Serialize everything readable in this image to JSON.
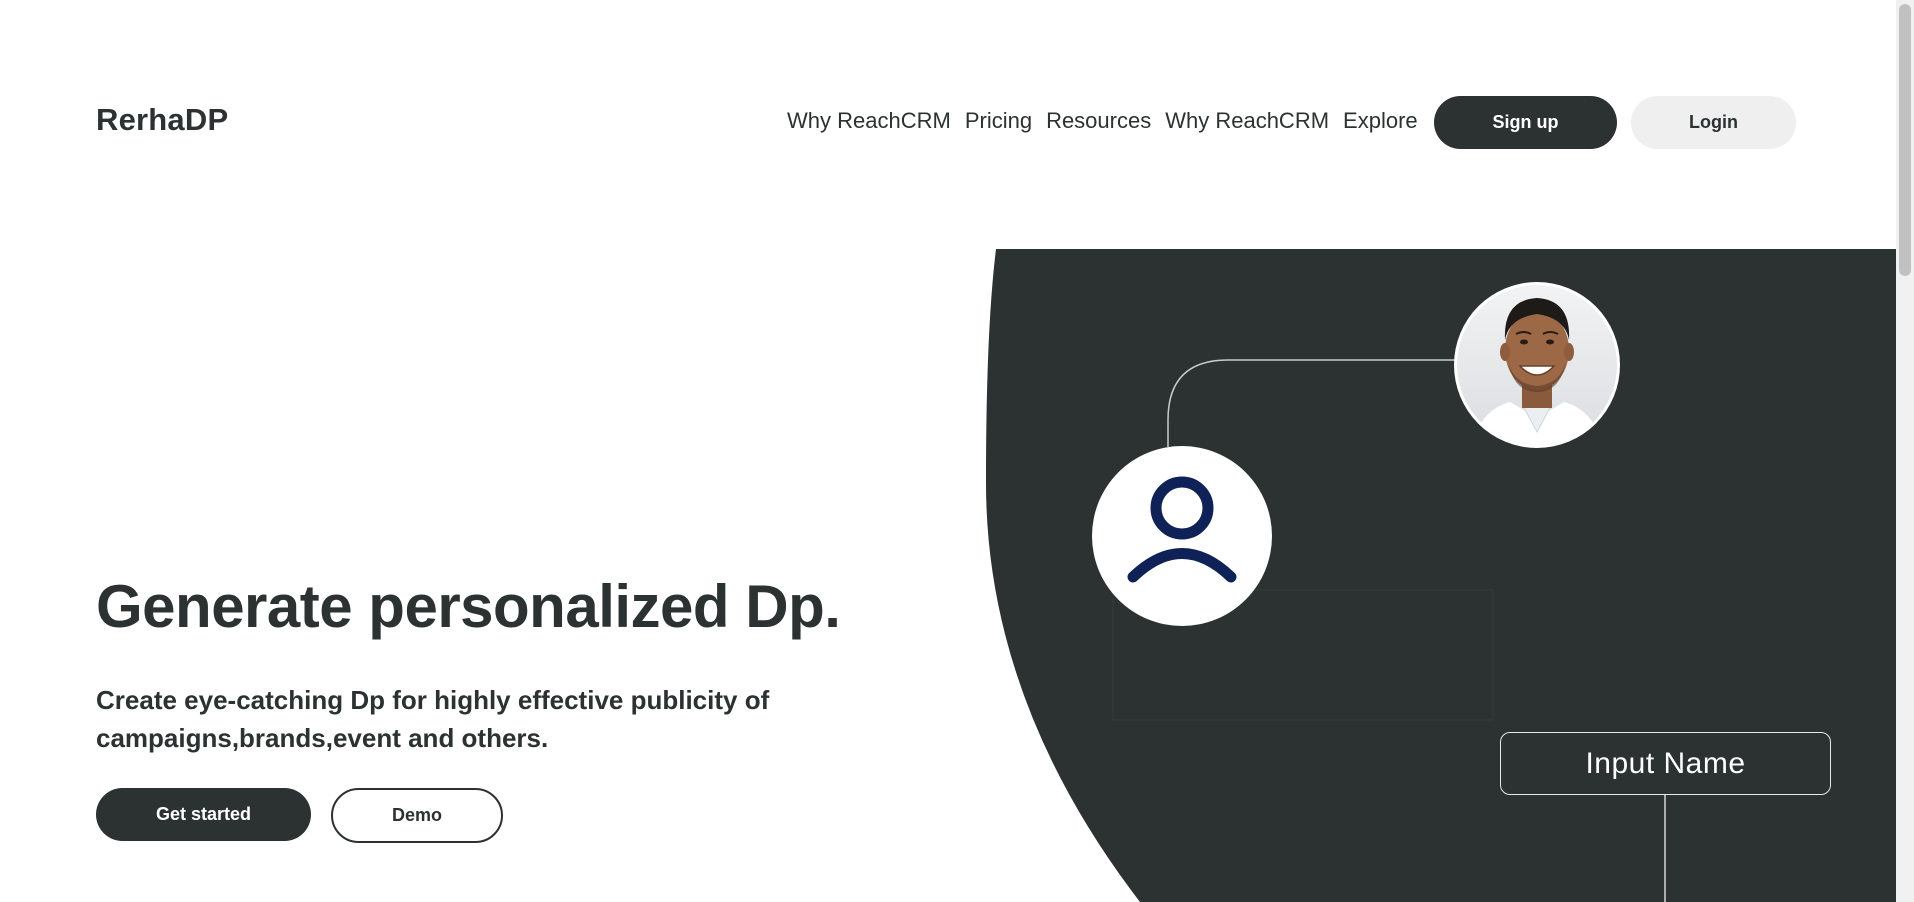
{
  "header": {
    "logo": "RerhaDP",
    "nav": [
      "Why ReachCRM",
      "Pricing",
      "Resources",
      "Why ReachCRM",
      "Explore"
    ],
    "signup_label": "Sign up",
    "login_label": "Login"
  },
  "hero": {
    "title": "Generate personalized Dp.",
    "subtitle": "Create eye-catching Dp for highly effective publicity of campaigns,brands,event and others.",
    "get_started_label": "Get started",
    "demo_label": "Demo"
  },
  "illustration": {
    "input_name_label": "Input Name",
    "panel_color": "#2c3131",
    "avatar_icon_color": "#0f2258"
  }
}
